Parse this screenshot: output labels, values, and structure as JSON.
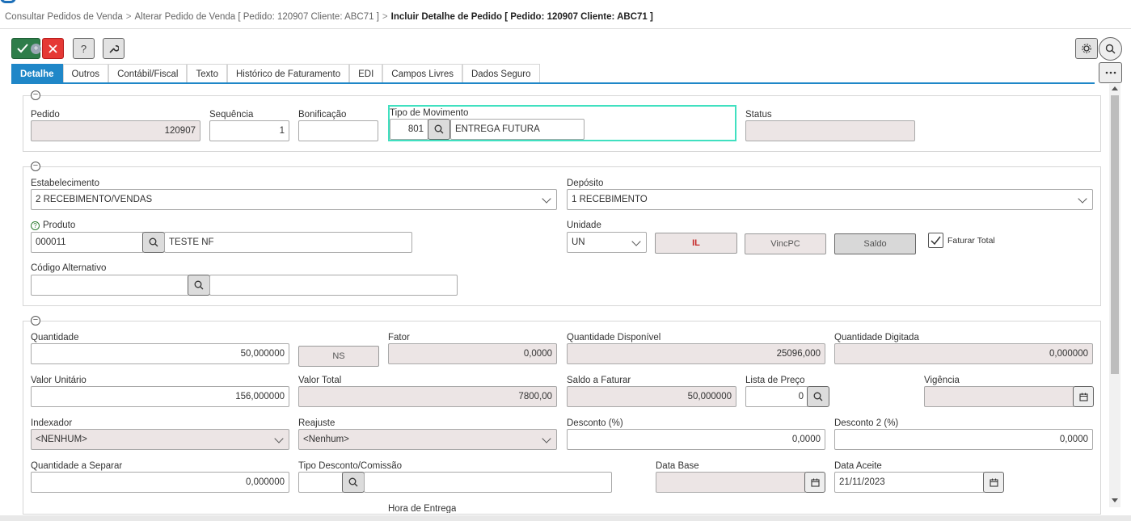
{
  "breadcrumb": {
    "item1": "Consultar Pedidos de Venda",
    "item2": "Alterar Pedido de Venda [ Pedido: 120907 Cliente: ABC71 ]",
    "current": "Incluir Detalhe de Pedido [ Pedido: 120907 Cliente: ABC71 ]",
    "separator": ">"
  },
  "toolbar": {
    "ok_icon": "check-icon",
    "ok_badge": "+",
    "cancel_icon": "close-icon",
    "help_label": "?",
    "tools_icon": "wrench-icon"
  },
  "tabs": [
    {
      "label": "Detalhe",
      "active": true
    },
    {
      "label": "Outros"
    },
    {
      "label": "Contábil/Fiscal"
    },
    {
      "label": "Texto"
    },
    {
      "label": "Histórico de Faturamento"
    },
    {
      "label": "EDI"
    },
    {
      "label": "Campos Livres"
    },
    {
      "label": "Dados Seguro"
    }
  ],
  "collapse_symbol": "−",
  "section1": {
    "pedido_label": "Pedido",
    "pedido_value": "120907",
    "sequencia_label": "Sequência",
    "sequencia_value": "1",
    "bonificacao_label": "Bonificação",
    "bonificacao_value": "",
    "tipo_mov_label": "Tipo de Movimento",
    "tipo_mov_code": "801",
    "tipo_mov_desc": "ENTREGA FUTURA",
    "status_label": "Status",
    "status_value": ""
  },
  "section2": {
    "estab_label": "Estabelecimento",
    "estab_value": "2 RECEBIMENTO/VENDAS",
    "deposito_label": "Depósito",
    "deposito_value": "1 RECEBIMENTO",
    "produto_help": "?",
    "produto_label": "Produto",
    "produto_code": "000011",
    "produto_desc": "TESTE NF",
    "unidade_label": "Unidade",
    "unidade_value": "UN",
    "btn_ll": "IL",
    "btn_vincpc": "VincPC",
    "btn_saldo": "Saldo",
    "faturar_total_label": "Faturar Total",
    "faturar_total_checked": true,
    "cod_alt_label": "Código Alternativo",
    "cod_alt_value": "",
    "cod_alt_desc": ""
  },
  "section3": {
    "quantidade_label": "Quantidade",
    "quantidade_value": "50,000000",
    "ns_btn": "NS",
    "fator_label": "Fator",
    "fator_value": "0,0000",
    "qtd_disp_label": "Quantidade Disponível",
    "qtd_disp_value": "25096,000",
    "qtd_dig_label": "Quantidade Digitada",
    "qtd_dig_value": "0,000000",
    "valor_unit_label": "Valor Unitário",
    "valor_unit_value": "156,000000",
    "valor_total_label": "Valor Total",
    "valor_total_value": "7800,00",
    "saldo_fat_label": "Saldo a Faturar",
    "saldo_fat_value": "50,000000",
    "lista_preco_label": "Lista de Preço",
    "lista_preco_value": "0",
    "vigencia_label": "Vigência",
    "vigencia_value": "",
    "indexador_label": "Indexador",
    "indexador_value": "<NENHUM>",
    "reajuste_label": "Reajuste",
    "reajuste_value": "<Nenhum>",
    "desconto_label": "Desconto (%)",
    "desconto_value": "0,0000",
    "desconto2_label": "Desconto 2 (%)",
    "desconto2_value": "0,0000",
    "qtd_sep_label": "Quantidade a Separar",
    "qtd_sep_value": "0,000000",
    "tipo_desc_label": "Tipo Desconto/Comissão",
    "tipo_desc_code": "",
    "tipo_desc_desc": "",
    "data_base_label": "Data Base",
    "data_base_value": "",
    "data_aceite_label": "Data Aceite",
    "data_aceite_value": "21/11/2023",
    "hora_entrega_label": "Hora de Entrega"
  },
  "colors": {
    "accent": "#1f87c8",
    "ok": "#2e7d4a",
    "cancel": "#e53935",
    "readonly": "#ece5e5",
    "focus": "#40e0c0"
  }
}
